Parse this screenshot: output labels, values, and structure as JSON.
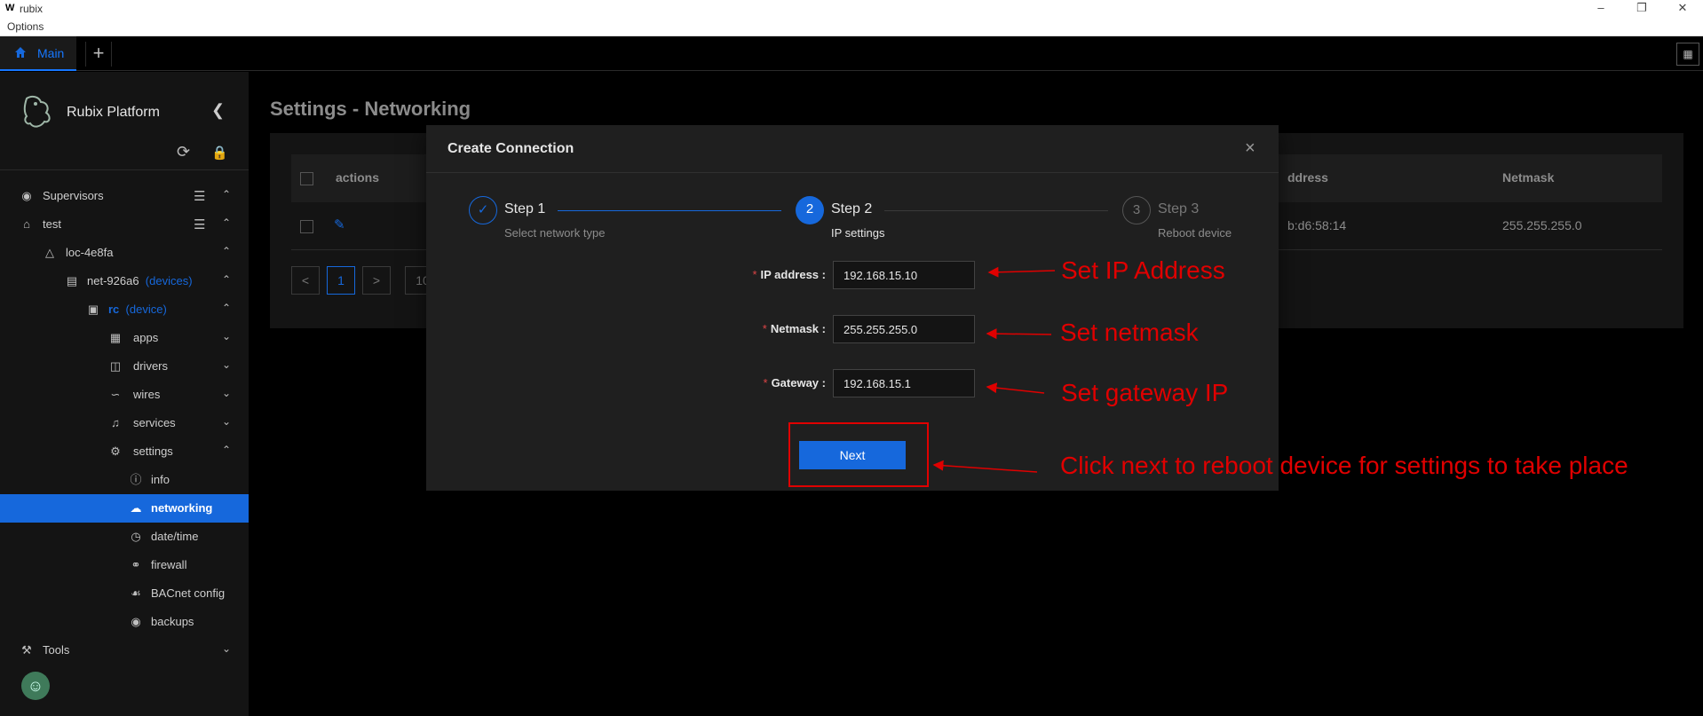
{
  "window": {
    "title": "rubix",
    "menu": "Options"
  },
  "tabs": {
    "main_label": "Main",
    "add_label": "+"
  },
  "sidebar": {
    "brand": "Rubix Platform",
    "items": [
      {
        "label": "Supervisors",
        "sub": ""
      },
      {
        "label": "test",
        "sub": ""
      },
      {
        "label": "loc-4e8fa",
        "sub": ""
      },
      {
        "label": "net-926a6",
        "sub": "(devices)"
      },
      {
        "label": "rc",
        "sub": "(device)"
      },
      {
        "label": "apps",
        "sub": ""
      },
      {
        "label": "drivers",
        "sub": ""
      },
      {
        "label": "wires",
        "sub": ""
      },
      {
        "label": "services",
        "sub": ""
      },
      {
        "label": "settings",
        "sub": ""
      },
      {
        "label": "info",
        "sub": ""
      },
      {
        "label": "networking",
        "sub": ""
      },
      {
        "label": "date/time",
        "sub": ""
      },
      {
        "label": "firewall",
        "sub": ""
      },
      {
        "label": "BACnet config",
        "sub": ""
      },
      {
        "label": "backups",
        "sub": ""
      },
      {
        "label": "Tools",
        "sub": ""
      }
    ]
  },
  "page": {
    "title": "Settings - Networking"
  },
  "table": {
    "headers": {
      "actions": "actions",
      "address": "ddress",
      "netmask": "Netmask"
    },
    "row": {
      "address": "b:d6:58:14",
      "netmask": "255.255.255.0"
    },
    "pagination": {
      "prev": "<",
      "current": "1",
      "next": ">",
      "size": "10"
    }
  },
  "modal": {
    "title": "Create Connection",
    "close": "×",
    "steps": [
      {
        "number": "✓",
        "title": "Step 1",
        "desc": "Select network type"
      },
      {
        "number": "2",
        "title": "Step 2",
        "desc": "IP settings"
      },
      {
        "number": "3",
        "title": "Step 3",
        "desc": "Reboot device"
      }
    ],
    "fields": {
      "ip": {
        "label": "IP address",
        "value": "192.168.15.10"
      },
      "netmask": {
        "label": "Netmask",
        "value": "255.255.255.0"
      },
      "gateway": {
        "label": "Gateway",
        "value": "192.168.15.1"
      }
    },
    "next_label": "Next"
  },
  "annotations": {
    "ip": "Set IP Address",
    "netmask": "Set netmask",
    "gateway": "Set gateway IP",
    "next": "Click next to reboot device for settings to take place"
  },
  "colors": {
    "accent": "#1668dc",
    "annotation": "#e00000",
    "background": "#000000"
  }
}
